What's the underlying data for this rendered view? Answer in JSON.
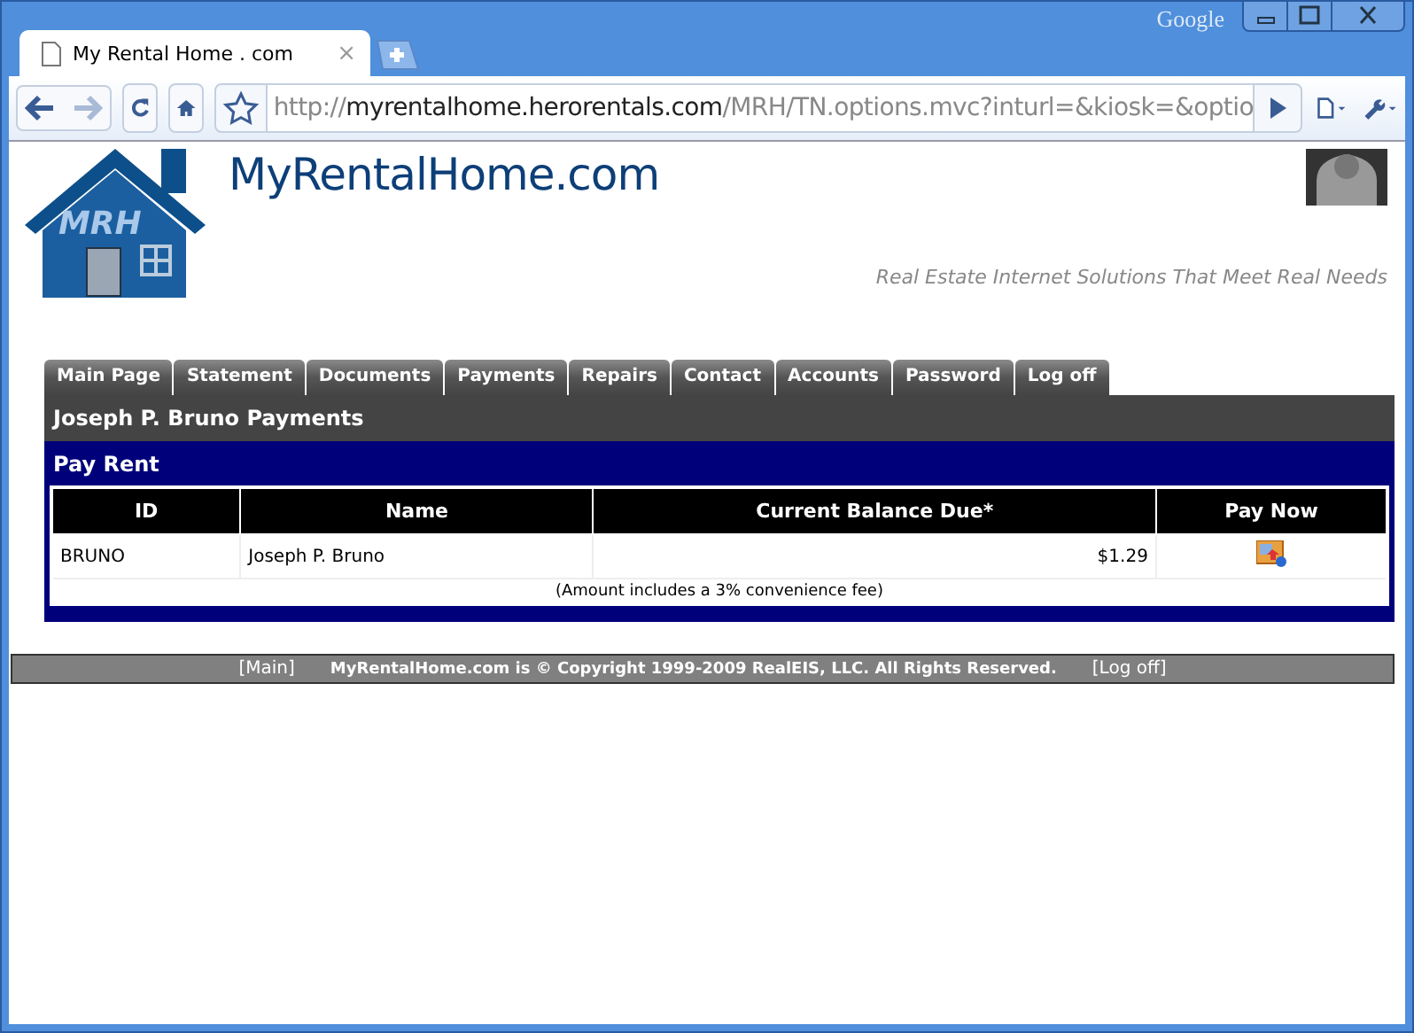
{
  "browser": {
    "tab_title": "My Rental Home . com",
    "tab_close": "×",
    "brand": "Google",
    "url": {
      "scheme": "http://",
      "host": "myrentalhome.herorentals.com",
      "path": "/MRH/TN.options.mvc?inturl=&kiosk=&optio"
    }
  },
  "site": {
    "logo_badge": "MRH",
    "brand": "MyRentalHome.com",
    "tagline": "Real Estate Internet Solutions That Meet Real Needs"
  },
  "nav_tabs": [
    {
      "label": "Main Page",
      "selected": false
    },
    {
      "label": "Statement",
      "selected": false
    },
    {
      "label": "Documents",
      "selected": false
    },
    {
      "label": "Payments",
      "selected": false
    },
    {
      "label": "Repairs",
      "selected": false
    },
    {
      "label": "Contact",
      "selected": false
    },
    {
      "label": "Accounts",
      "selected": false
    },
    {
      "label": "Password",
      "selected": false
    },
    {
      "label": "Log off",
      "selected": false
    }
  ],
  "page_title": "Joseph P. Bruno Payments",
  "section_title": "Pay Rent",
  "table": {
    "columns": [
      "ID",
      "Name",
      "Current Balance Due*",
      "Pay Now"
    ],
    "rows": [
      {
        "id": "BRUNO",
        "name": "Joseph P. Bruno",
        "balance": "$1.29"
      }
    ],
    "note": "(Amount includes a 3% convenience fee)"
  },
  "footer": {
    "main_link": "[Main]",
    "copyright": "MyRentalHome.com is © Copyright 1999-2009 RealEIS, LLC. All Rights Reserved.",
    "logoff_link": "[Log off]"
  }
}
